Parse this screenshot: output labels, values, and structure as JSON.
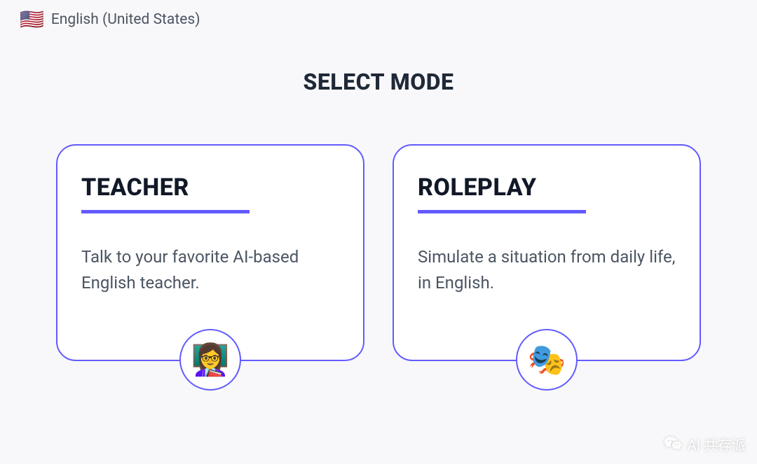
{
  "header": {
    "language_flag": "🇺🇸",
    "language_label": "English (United States)"
  },
  "page_title": "SELECT MODE",
  "modes": [
    {
      "title": "TEACHER",
      "description": "Talk to your favorite AI-based English teacher.",
      "icon": "👩‍🏫"
    },
    {
      "title": "ROLEPLAY",
      "description": "Simulate a situation from daily life, in English.",
      "icon": "🎭"
    }
  ],
  "attribution": {
    "text": "AI 共存派"
  },
  "colors": {
    "accent": "#635bff",
    "bg": "#f8f8fa",
    "heading": "#111827",
    "body": "#4b5563"
  }
}
